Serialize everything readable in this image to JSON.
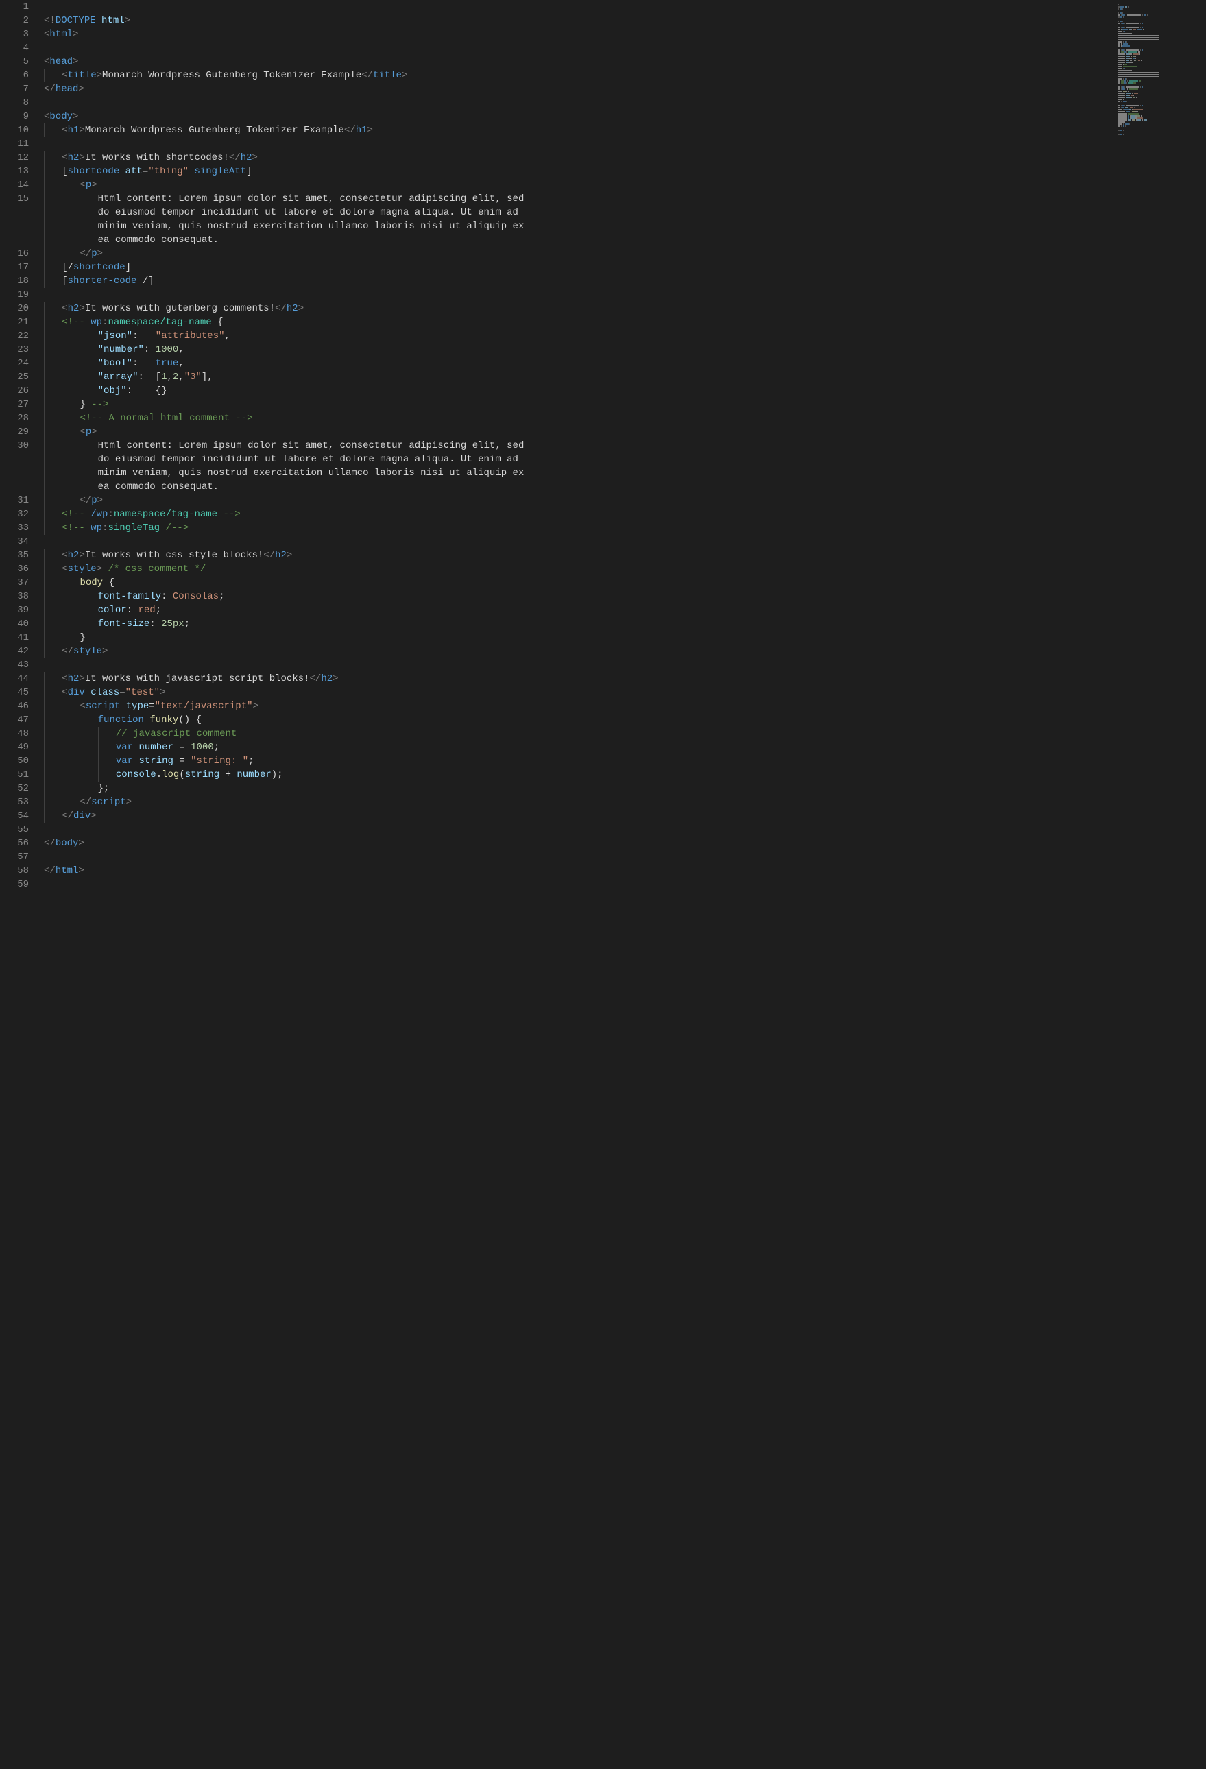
{
  "lineCount": 59,
  "lines": [
    [
      [
        "punct",
        ""
      ]
    ],
    [
      [
        "punct",
        "<!"
      ],
      [
        "tag",
        "DOCTYPE "
      ],
      [
        "attr",
        "html"
      ],
      [
        "punct",
        ">"
      ]
    ],
    [
      [
        "punct",
        "<"
      ],
      [
        "tag",
        "html"
      ],
      [
        "punct",
        ">"
      ]
    ],
    [],
    [
      [
        "punct",
        "<"
      ],
      [
        "tag",
        "head"
      ],
      [
        "punct",
        ">"
      ]
    ],
    [
      [
        "text",
        "    "
      ],
      [
        "punct",
        "<"
      ],
      [
        "tag",
        "title"
      ],
      [
        "punct",
        ">"
      ],
      [
        "text",
        "Monarch Wordpress Gutenberg Tokenizer Example"
      ],
      [
        "punct",
        "</"
      ],
      [
        "tag",
        "title"
      ],
      [
        "punct",
        ">"
      ]
    ],
    [
      [
        "punct",
        "</"
      ],
      [
        "tag",
        "head"
      ],
      [
        "punct",
        ">"
      ]
    ],
    [],
    [
      [
        "punct",
        "<"
      ],
      [
        "tag",
        "body"
      ],
      [
        "punct",
        ">"
      ]
    ],
    [
      [
        "text",
        "    "
      ],
      [
        "punct",
        "<"
      ],
      [
        "tag",
        "h1"
      ],
      [
        "punct",
        ">"
      ],
      [
        "text",
        "Monarch Wordpress Gutenberg Tokenizer Example"
      ],
      [
        "punct",
        "</"
      ],
      [
        "tag",
        "h1"
      ],
      [
        "punct",
        ">"
      ]
    ],
    [],
    [
      [
        "text",
        "    "
      ],
      [
        "punct",
        "<"
      ],
      [
        "tag",
        "h2"
      ],
      [
        "punct",
        ">"
      ],
      [
        "text",
        "It works with shortcodes!"
      ],
      [
        "punct",
        "</"
      ],
      [
        "tag",
        "h2"
      ],
      [
        "punct",
        ">"
      ]
    ],
    [
      [
        "text",
        "    "
      ],
      [
        "delim",
        "["
      ],
      [
        "tag",
        "shortcode "
      ],
      [
        "attr",
        "att"
      ],
      [
        "delim",
        "="
      ],
      [
        "string",
        "\"thing\""
      ],
      [
        "tag",
        " singleAtt"
      ],
      [
        "delim",
        "]"
      ]
    ],
    [
      [
        "text",
        "        "
      ],
      [
        "punct",
        "<"
      ],
      [
        "tag",
        "p"
      ],
      [
        "punct",
        ">"
      ]
    ],
    [
      [
        "text",
        "            Html content: Lorem ipsum dolor sit amet, consectetur adipiscing elit, sed"
      ]
    ],
    [
      [
        "text",
        "        "
      ],
      [
        "punct",
        "</"
      ],
      [
        "tag",
        "p"
      ],
      [
        "punct",
        ">"
      ]
    ],
    [
      [
        "text",
        "    "
      ],
      [
        "delim",
        "[/"
      ],
      [
        "tag",
        "shortcode"
      ],
      [
        "delim",
        "]"
      ]
    ],
    [
      [
        "text",
        "    "
      ],
      [
        "delim",
        "["
      ],
      [
        "tag",
        "shorter-code "
      ],
      [
        "delim",
        "/]"
      ]
    ],
    [],
    [
      [
        "text",
        "    "
      ],
      [
        "punct",
        "<"
      ],
      [
        "tag",
        "h2"
      ],
      [
        "punct",
        ">"
      ],
      [
        "text",
        "It works with gutenberg comments!"
      ],
      [
        "punct",
        "</"
      ],
      [
        "tag",
        "h2"
      ],
      [
        "punct",
        ">"
      ]
    ],
    [
      [
        "text",
        "    "
      ],
      [
        "comment",
        "<!-- "
      ],
      [
        "tag",
        "wp"
      ],
      [
        "punct",
        ":"
      ],
      [
        "type",
        "namespace/tag-name"
      ],
      [
        "text",
        " "
      ],
      [
        "delim",
        "{"
      ]
    ],
    [
      [
        "text",
        "            "
      ],
      [
        "attr",
        "\"json\""
      ],
      [
        "delim",
        ":   "
      ],
      [
        "string",
        "\"attributes\""
      ],
      [
        "delim",
        ","
      ]
    ],
    [
      [
        "text",
        "            "
      ],
      [
        "attr",
        "\"number\""
      ],
      [
        "delim",
        ": "
      ],
      [
        "number",
        "1000"
      ],
      [
        "delim",
        ","
      ]
    ],
    [
      [
        "text",
        "            "
      ],
      [
        "attr",
        "\"bool\""
      ],
      [
        "delim",
        ":   "
      ],
      [
        "tag",
        "true"
      ],
      [
        "delim",
        ","
      ]
    ],
    [
      [
        "text",
        "            "
      ],
      [
        "attr",
        "\"array\""
      ],
      [
        "delim",
        ":  ["
      ],
      [
        "number",
        "1"
      ],
      [
        "delim",
        ","
      ],
      [
        "number",
        "2"
      ],
      [
        "delim",
        ","
      ],
      [
        "string",
        "\"3\""
      ],
      [
        "delim",
        "],"
      ]
    ],
    [
      [
        "text",
        "            "
      ],
      [
        "attr",
        "\"obj\""
      ],
      [
        "delim",
        ":    {}"
      ]
    ],
    [
      [
        "text",
        "        "
      ],
      [
        "delim",
        "}"
      ],
      [
        "comment",
        " -->"
      ]
    ],
    [
      [
        "text",
        "        "
      ],
      [
        "comment",
        "<!-- A normal html comment -->"
      ]
    ],
    [
      [
        "text",
        "        "
      ],
      [
        "punct",
        "<"
      ],
      [
        "tag",
        "p"
      ],
      [
        "punct",
        ">"
      ]
    ],
    [
      [
        "text",
        "            Html content: Lorem ipsum dolor sit amet, consectetur adipiscing elit, sed"
      ]
    ],
    [
      [
        "text",
        "        "
      ],
      [
        "punct",
        "</"
      ],
      [
        "tag",
        "p"
      ],
      [
        "punct",
        ">"
      ]
    ],
    [
      [
        "text",
        "    "
      ],
      [
        "comment",
        "<!-- "
      ],
      [
        "tag",
        "/wp"
      ],
      [
        "punct",
        ":"
      ],
      [
        "type",
        "namespace/tag-name"
      ],
      [
        "comment",
        " -->"
      ]
    ],
    [
      [
        "text",
        "    "
      ],
      [
        "comment",
        "<!-- "
      ],
      [
        "tag",
        "wp"
      ],
      [
        "punct",
        ":"
      ],
      [
        "type",
        "singleTag"
      ],
      [
        "comment",
        " /-->"
      ]
    ],
    [],
    [
      [
        "text",
        "    "
      ],
      [
        "punct",
        "<"
      ],
      [
        "tag",
        "h2"
      ],
      [
        "punct",
        ">"
      ],
      [
        "text",
        "It works with css style blocks!"
      ],
      [
        "punct",
        "</"
      ],
      [
        "tag",
        "h2"
      ],
      [
        "punct",
        ">"
      ]
    ],
    [
      [
        "text",
        "    "
      ],
      [
        "punct",
        "<"
      ],
      [
        "tag",
        "style"
      ],
      [
        "punct",
        ">"
      ],
      [
        "text",
        " "
      ],
      [
        "comment",
        "/* css comment */"
      ]
    ],
    [
      [
        "text",
        "        "
      ],
      [
        "func",
        "body"
      ],
      [
        "text",
        " "
      ],
      [
        "delim",
        "{"
      ]
    ],
    [
      [
        "text",
        "            "
      ],
      [
        "attr",
        "font-family"
      ],
      [
        "delim",
        ": "
      ],
      [
        "string",
        "Consolas"
      ],
      [
        "delim",
        ";"
      ]
    ],
    [
      [
        "text",
        "            "
      ],
      [
        "attr",
        "color"
      ],
      [
        "delim",
        ": "
      ],
      [
        "string",
        "red"
      ],
      [
        "delim",
        ";"
      ]
    ],
    [
      [
        "text",
        "            "
      ],
      [
        "attr",
        "font-size"
      ],
      [
        "delim",
        ": "
      ],
      [
        "number",
        "25px"
      ],
      [
        "delim",
        ";"
      ]
    ],
    [
      [
        "text",
        "        "
      ],
      [
        "delim",
        "}"
      ]
    ],
    [
      [
        "text",
        "    "
      ],
      [
        "punct",
        "</"
      ],
      [
        "tag",
        "style"
      ],
      [
        "punct",
        ">"
      ]
    ],
    [],
    [
      [
        "text",
        "    "
      ],
      [
        "punct",
        "<"
      ],
      [
        "tag",
        "h2"
      ],
      [
        "punct",
        ">"
      ],
      [
        "text",
        "It works with javascript script blocks!"
      ],
      [
        "punct",
        "</"
      ],
      [
        "tag",
        "h2"
      ],
      [
        "punct",
        ">"
      ]
    ],
    [
      [
        "text",
        "    "
      ],
      [
        "punct",
        "<"
      ],
      [
        "tag",
        "div "
      ],
      [
        "attr",
        "class"
      ],
      [
        "delim",
        "="
      ],
      [
        "string",
        "\"test\""
      ],
      [
        "punct",
        ">"
      ]
    ],
    [
      [
        "text",
        "        "
      ],
      [
        "punct",
        "<"
      ],
      [
        "tag",
        "script "
      ],
      [
        "attr",
        "type"
      ],
      [
        "delim",
        "="
      ],
      [
        "string",
        "\"text/javascript\""
      ],
      [
        "punct",
        ">"
      ]
    ],
    [
      [
        "text",
        "            "
      ],
      [
        "tag",
        "function"
      ],
      [
        "text",
        " "
      ],
      [
        "func",
        "funky"
      ],
      [
        "delim",
        "()"
      ],
      [
        "text",
        " "
      ],
      [
        "delim",
        "{"
      ]
    ],
    [
      [
        "text",
        "                "
      ],
      [
        "comment",
        "// javascript comment"
      ]
    ],
    [
      [
        "text",
        "                "
      ],
      [
        "tag",
        "var"
      ],
      [
        "text",
        " "
      ],
      [
        "attr",
        "number"
      ],
      [
        "text",
        " = "
      ],
      [
        "number",
        "1000"
      ],
      [
        "delim",
        ";"
      ]
    ],
    [
      [
        "text",
        "                "
      ],
      [
        "tag",
        "var"
      ],
      [
        "text",
        " "
      ],
      [
        "attr",
        "string"
      ],
      [
        "text",
        " = "
      ],
      [
        "string",
        "\"string: \""
      ],
      [
        "delim",
        ";"
      ]
    ],
    [
      [
        "text",
        "                "
      ],
      [
        "attr",
        "console"
      ],
      [
        "delim",
        "."
      ],
      [
        "func",
        "log"
      ],
      [
        "delim",
        "("
      ],
      [
        "attr",
        "string"
      ],
      [
        "text",
        " + "
      ],
      [
        "attr",
        "number"
      ],
      [
        "delim",
        ");"
      ]
    ],
    [
      [
        "text",
        "            "
      ],
      [
        "delim",
        "};"
      ]
    ],
    [
      [
        "text",
        "        "
      ],
      [
        "punct",
        "</"
      ],
      [
        "tag",
        "script"
      ],
      [
        "punct",
        ">"
      ]
    ],
    [
      [
        "text",
        "    "
      ],
      [
        "punct",
        "</"
      ],
      [
        "tag",
        "div"
      ],
      [
        "punct",
        ">"
      ]
    ],
    [],
    [
      [
        "punct",
        "</"
      ],
      [
        "tag",
        "body"
      ],
      [
        "punct",
        ">"
      ]
    ],
    [],
    [
      [
        "punct",
        "</"
      ],
      [
        "tag",
        "html"
      ],
      [
        "punct",
        ">"
      ]
    ],
    []
  ],
  "wrappedExtra": {
    "15": [
      "            do eiusmod tempor incididunt ut labore et dolore magna aliqua. Ut enim ad",
      "            minim veniam, quis nostrud exercitation ullamco laboris nisi ut aliquip ex",
      "            ea commodo consequat."
    ],
    "30": [
      "            do eiusmod tempor incididunt ut labore et dolore magna aliqua. Ut enim ad",
      "            minim veniam, quis nostrud exercitation ullamco laboris nisi ut aliquip ex",
      "            ea commodo consequat."
    ]
  },
  "minimap": {
    "present": true
  }
}
